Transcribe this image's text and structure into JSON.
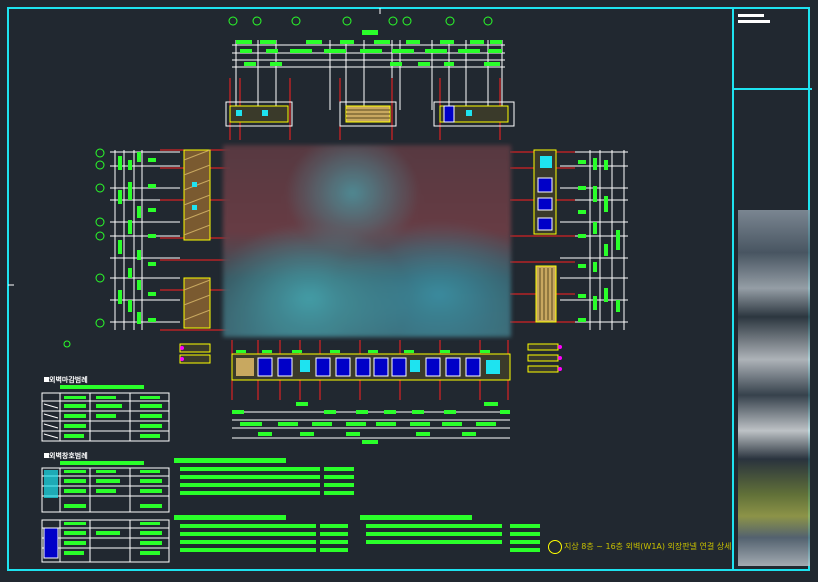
{
  "drawing": {
    "title_text": "지상 8층 ~ 16층 외벽(W1A) 외장판넬 연결 상세",
    "table1_title": "외벽마감범례",
    "table2_title": "외벽창호범례",
    "accent_color": "#1ee3f0",
    "line_color": "#2aff2a",
    "dim_color": "#ff2020",
    "panel_color": "#0000c8",
    "background": "#212830"
  }
}
